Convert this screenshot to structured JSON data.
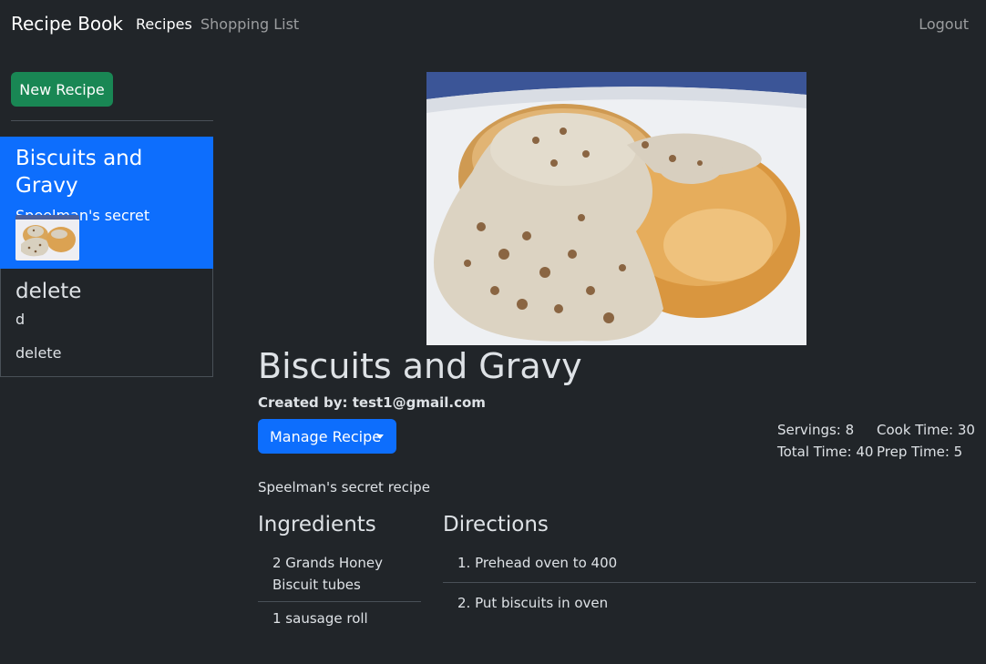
{
  "nav": {
    "brand": "Recipe Book",
    "recipes": "Recipes",
    "shopping_list": "Shopping List",
    "logout": "Logout"
  },
  "sidebar": {
    "new_recipe_label": "New Recipe",
    "items": [
      {
        "title": "Biscuits and Gravy",
        "description": "Speelman's secret recipe",
        "active": true
      },
      {
        "title": "delete",
        "description": "d",
        "extra": "delete",
        "active": false
      }
    ]
  },
  "recipe": {
    "title": "Biscuits and Gravy",
    "created_by": "Created by: test1@gmail.com",
    "manage_label": "Manage Recipe",
    "servings": "Servings: 8",
    "cook_time": "Cook Time: 30",
    "total_time": "Total Time: 40",
    "prep_time": "Prep Time: 5",
    "description": "Speelman's secret recipe",
    "ingredients_heading": "Ingredients",
    "directions_heading": "Directions",
    "ingredients": [
      {
        "line1": "2 Grands Honey",
        "line2": "Biscuit tubes"
      },
      {
        "line1": "1 sausage roll"
      }
    ],
    "directions": [
      "1. Prehead oven to 400",
      "2. Put biscuits in oven"
    ]
  },
  "colors": {
    "background": "#212529",
    "primary": "#0d6efd",
    "success": "#198754"
  }
}
